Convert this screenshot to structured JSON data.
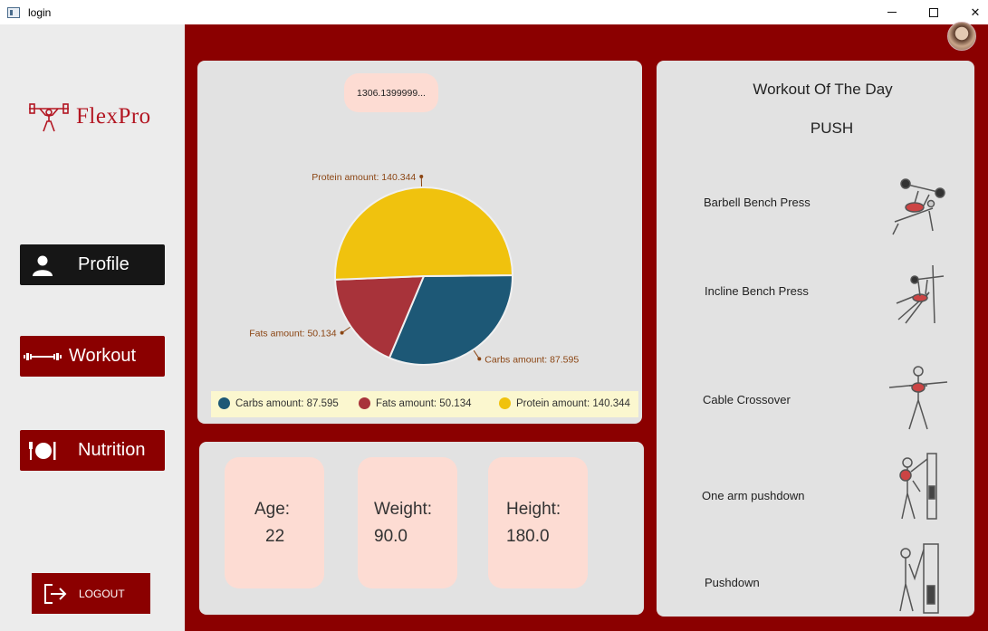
{
  "window": {
    "title": "login"
  },
  "sidebar": {
    "logo_text": "FlexPro",
    "profile_label": "Profile",
    "workout_label": "Workout",
    "nutrition_label": "Nutrition",
    "logout_label": "LOGOUT"
  },
  "nutrition": {
    "total_calories": "1306.1399999...",
    "chart_data": {
      "type": "pie",
      "slices": [
        {
          "name": "Carbs amount: 87.595",
          "value": 87.595,
          "color": "#1d5876"
        },
        {
          "name": "Fats amount: 50.134",
          "value": 50.134,
          "color": "#a8333a"
        },
        {
          "name": "Protein amount: 140.344",
          "value": 140.344,
          "color": "#f0c20e"
        }
      ],
      "legend_position": "bottom"
    }
  },
  "stats": {
    "age_label": "Age:",
    "age_value": "22",
    "weight_label": "Weight:",
    "weight_value": "90.0",
    "height_label": "Height:",
    "height_value": "180.0"
  },
  "workout": {
    "title": "Workout Of The Day",
    "split": "PUSH",
    "exercises": [
      {
        "name": "Barbell Bench Press"
      },
      {
        "name": "Incline Bench Press"
      },
      {
        "name": "Cable Crossover"
      },
      {
        "name": "One arm pushdown"
      },
      {
        "name": "Pushdown"
      }
    ]
  },
  "colors": {
    "brand_red": "#8b0000",
    "logo_red": "#b31622",
    "card_peach": "#fddcd3",
    "legend_bg": "#fbf7cf"
  }
}
